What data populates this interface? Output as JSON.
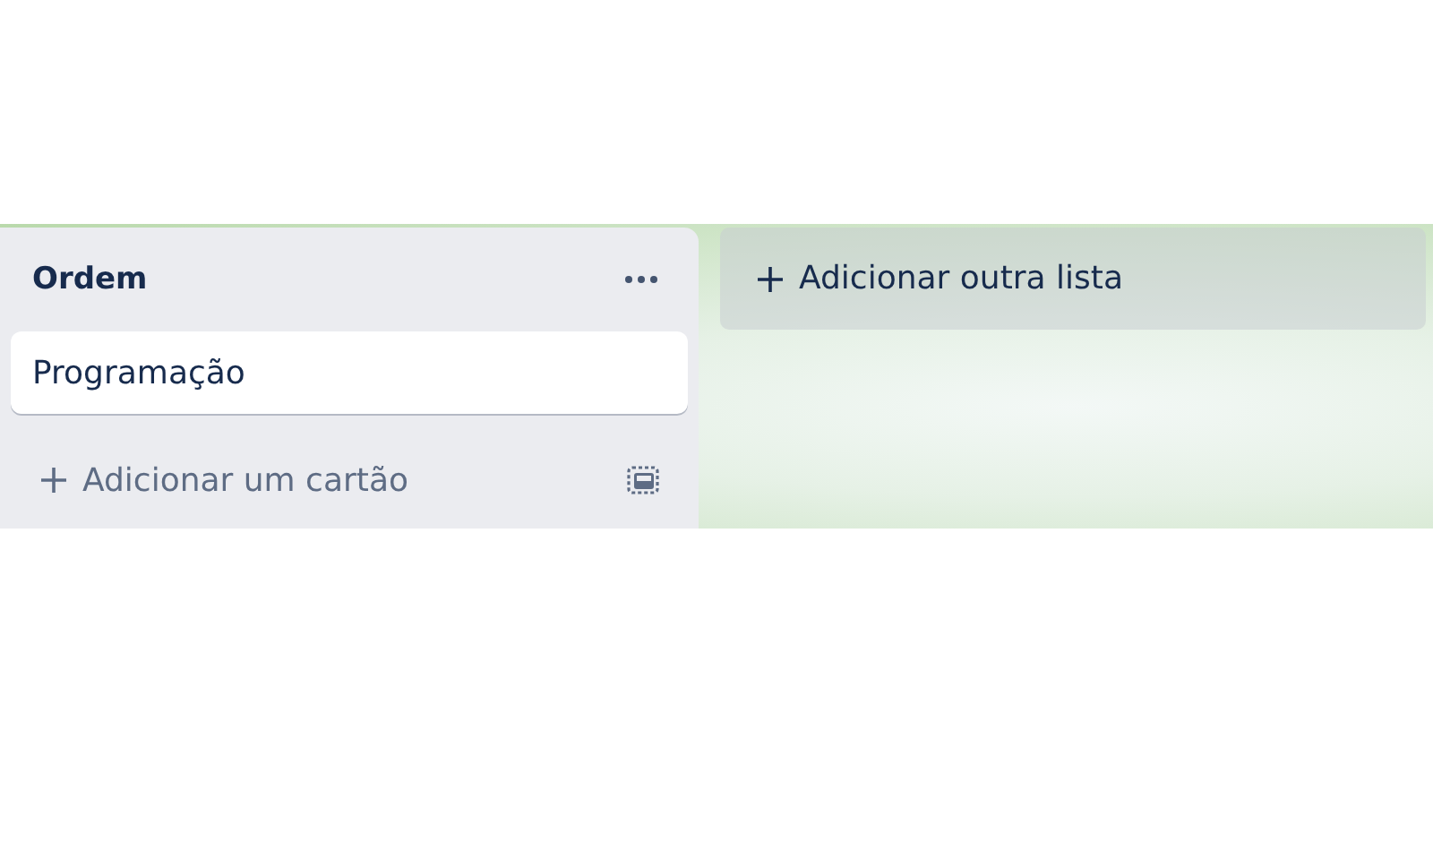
{
  "lists": [
    {
      "title": "Ordem",
      "cards": [
        {
          "title": "Programação"
        }
      ],
      "add_card_label": "Adicionar um cartão"
    }
  ],
  "add_list_label": "Adicionar outra lista"
}
